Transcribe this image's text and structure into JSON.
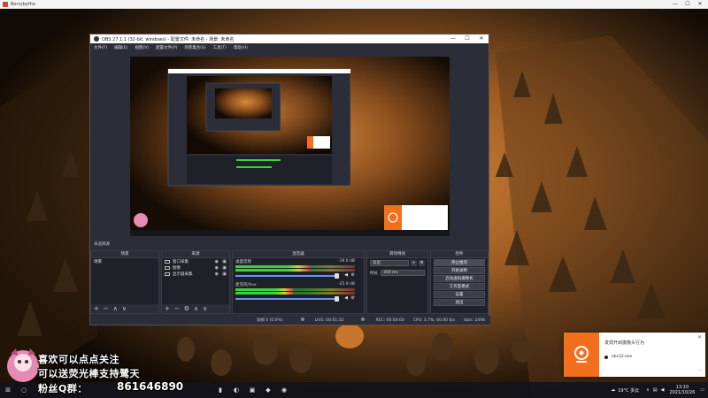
{
  "host": {
    "title": "Berrybytho",
    "minimize": "—",
    "maximize": "☐",
    "close": "✕"
  },
  "obs": {
    "title": "OBS 27.1.1 (32-bit, windows) - 配置文件: 未命名 - 场景: 未命名",
    "minimize": "—",
    "maximize": "☐",
    "close": "✕",
    "menu": [
      "文件(F)",
      "编辑(E)",
      "视图(V)",
      "配置文件(P)",
      "场景集合(S)",
      "工具(T)",
      "帮助(H)"
    ],
    "scene_label": "未选择源",
    "docks": {
      "scenes": {
        "title": "场景",
        "items": [
          "场景"
        ]
      },
      "sources": {
        "title": "来源",
        "items": [
          {
            "name": "窗口采集"
          },
          {
            "name": "图像"
          },
          {
            "name": "显示器采集"
          }
        ]
      },
      "mixer": {
        "title": "混音器",
        "channels": [
          {
            "name": "桌面音频",
            "db": "-19.0 dB",
            "level": 0.62
          },
          {
            "name": "麦克风/Aux",
            "db": "-25.9 dB",
            "level": 0.48
          }
        ]
      },
      "transitions": {
        "title": "转场特效",
        "type": "淡出",
        "duration_label": "时长",
        "duration": "300 ms"
      },
      "controls": {
        "title": "控件",
        "buttons": [
          "停止推流",
          "开始录制",
          "启动虚拟摄像机",
          "工作室模式",
          "设置",
          "退出"
        ]
      }
    },
    "statusbar": {
      "dropped": "丢帧 0 (0.0%)",
      "live": "LIVE: 00:01:32",
      "rec": "REC: 00:00:00",
      "cpu": "CPU: 3.7%, 60.00 fps",
      "kbps": "kb/s: 2498"
    },
    "footer_glyphs": {
      "add": "+",
      "remove": "−",
      "up": "∧",
      "down": "∨",
      "gear": "⚙"
    }
  },
  "overlay": {
    "line1": "喜欢可以点点关注",
    "line2": "可以送荧光棒支持鹭天",
    "line3": "粉丝Q群：",
    "qq": "861646890"
  },
  "taskbar": {
    "weather": "19°C 多云",
    "time": "13:10",
    "date": "2021/10/26"
  },
  "toast": {
    "title": "发现开启摄像头行为",
    "app": "obs32.exe",
    "close": "✕",
    "more": "···"
  },
  "colors": {
    "accent_orange": "#f26f1d",
    "obs_bg": "#2b2e38",
    "meter_green": "#3bd13b",
    "fader_blue": "#6c8ef0"
  }
}
